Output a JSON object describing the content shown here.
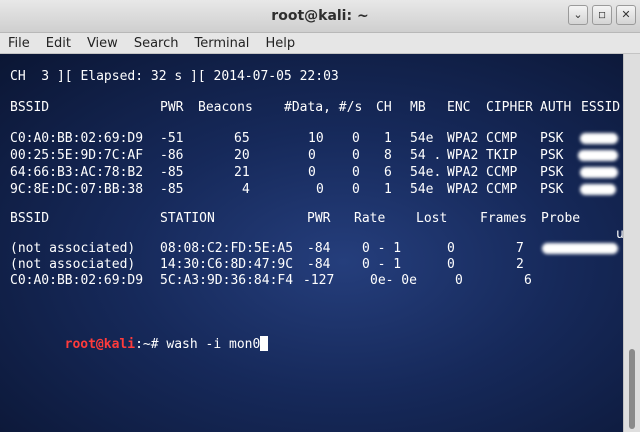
{
  "window": {
    "title": "root@kali: ~",
    "buttons": {
      "minimize": "⌄",
      "maximize": "◽",
      "close": "✕"
    }
  },
  "menubar": [
    "File",
    "Edit",
    "View",
    "Search",
    "Terminal",
    "Help"
  ],
  "terminal": {
    "status": "CH  3 ][ Elapsed: 32 s ][ 2014-07-05 22:03",
    "ap_headers": [
      "BSSID",
      "PWR",
      "Beacons",
      "#Data, #/s",
      "CH",
      "MB",
      "ENC",
      "CIPHER",
      "AUTH",
      "ESSID"
    ],
    "ap_rows": [
      [
        "C0:A0:BB:02:69:D9",
        "-51",
        "65",
        "10",
        "0",
        "1",
        "54e",
        "WPA2",
        "CCMP",
        "PSK"
      ],
      [
        "00:25:5E:9D:7C:AF",
        "-86",
        "20",
        "0",
        "0",
        "8",
        "54 .",
        "WPA2",
        "TKIP",
        "PSK"
      ],
      [
        "64:66:B3:AC:78:B2",
        "-85",
        "21",
        "0",
        "0",
        "6",
        "54e.",
        "WPA2",
        "CCMP",
        "PSK"
      ],
      [
        "9C:8E:DC:07:BB:38",
        "-85",
        "4",
        "0",
        "0",
        "1",
        "54e",
        "WPA2",
        "CCMP",
        "PSK"
      ]
    ],
    "sta_headers": [
      "BSSID",
      "STATION",
      "PWR",
      "Rate",
      "Lost",
      "Frames",
      "Probe"
    ],
    "sta_rows": [
      [
        "(not associated)",
        "08:08:C2:FD:5E:A5",
        "-84",
        "0 - 1",
        "0",
        "7"
      ],
      [
        "(not associated)",
        "14:30:C6:8D:47:9C",
        "-84",
        "0 - 1",
        "0",
        "2"
      ],
      [
        "C0:A0:BB:02:69:D9",
        "5C:A3:9D:36:84:F4",
        "-127",
        "0e- 0e",
        "0",
        "6"
      ]
    ],
    "probe_overflow": "u",
    "prompt": {
      "user": "root@kali",
      "rest": ":~# ",
      "command": "wash -i mon0"
    }
  },
  "colors": {
    "prompt_user": "#ff3b3b",
    "text": "#ffffff",
    "bg": "#16295a"
  }
}
